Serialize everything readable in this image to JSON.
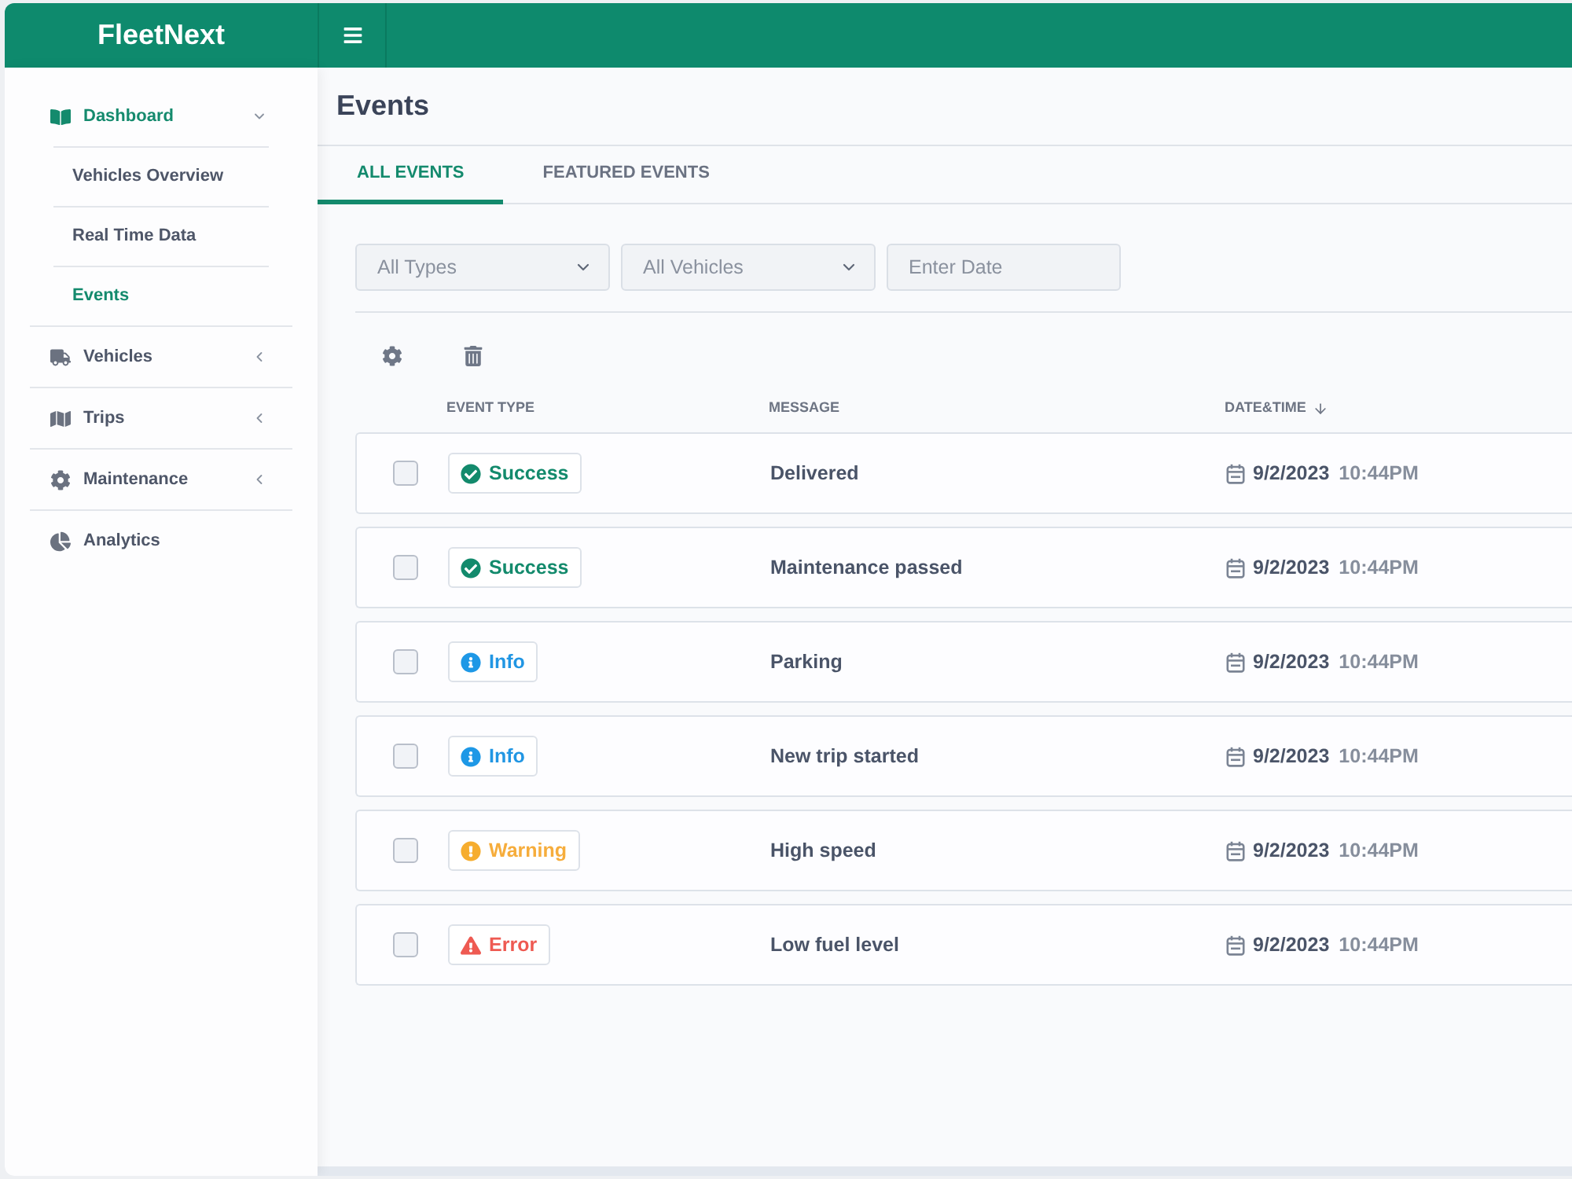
{
  "header": {
    "brand": "FleetNext"
  },
  "sidebar": {
    "items": [
      {
        "kind": "group",
        "label": "Dashboard",
        "selected": true,
        "expanded": true,
        "children": [
          {
            "label": "Vehicles Overview",
            "selected": false
          },
          {
            "label": "Real Time Data",
            "selected": false
          },
          {
            "label": "Events",
            "selected": true
          }
        ]
      },
      {
        "kind": "group",
        "label": "Vehicles",
        "selected": false,
        "expanded": false
      },
      {
        "kind": "group",
        "label": "Trips",
        "selected": false,
        "expanded": false
      },
      {
        "kind": "group",
        "label": "Maintenance",
        "selected": false,
        "expanded": false
      },
      {
        "kind": "link",
        "label": "Analytics",
        "selected": false
      }
    ]
  },
  "page": {
    "title": "Events"
  },
  "tabs": [
    {
      "label": "ALL EVENTS",
      "selected": true
    },
    {
      "label": "FEATURED EVENTS",
      "selected": false
    }
  ],
  "filters": [
    {
      "kind": "select",
      "value": "All Types"
    },
    {
      "kind": "select",
      "value": "All Vehicles"
    },
    {
      "kind": "date",
      "placeholder": "Enter Date"
    }
  ],
  "table": {
    "columns": [
      {
        "label": "EVENT TYPE",
        "sorted": false
      },
      {
        "label": "MESSAGE",
        "sorted": false
      },
      {
        "label": "DATE&TIME",
        "sorted": true
      }
    ],
    "rows": [
      {
        "checked": false,
        "type": {
          "kind": "success",
          "label": "Success"
        },
        "message": "Delivered",
        "date": "9/2/2023",
        "time": "10:44PM"
      },
      {
        "checked": false,
        "type": {
          "kind": "success",
          "label": "Success"
        },
        "message": "Maintenance passed",
        "date": "9/2/2023",
        "time": "10:44PM"
      },
      {
        "checked": false,
        "type": {
          "kind": "info",
          "label": "Info"
        },
        "message": "Parking",
        "date": "9/2/2023",
        "time": "10:44PM"
      },
      {
        "checked": false,
        "type": {
          "kind": "info",
          "label": "Info"
        },
        "message": "New trip started",
        "date": "9/2/2023",
        "time": "10:44PM"
      },
      {
        "checked": false,
        "type": {
          "kind": "warning",
          "label": "Warning"
        },
        "message": "High speed",
        "date": "9/2/2023",
        "time": "10:44PM"
      },
      {
        "checked": false,
        "type": {
          "kind": "error",
          "label": "Error"
        },
        "message": "Low fuel level",
        "date": "9/2/2023",
        "time": "10:44PM"
      }
    ]
  }
}
